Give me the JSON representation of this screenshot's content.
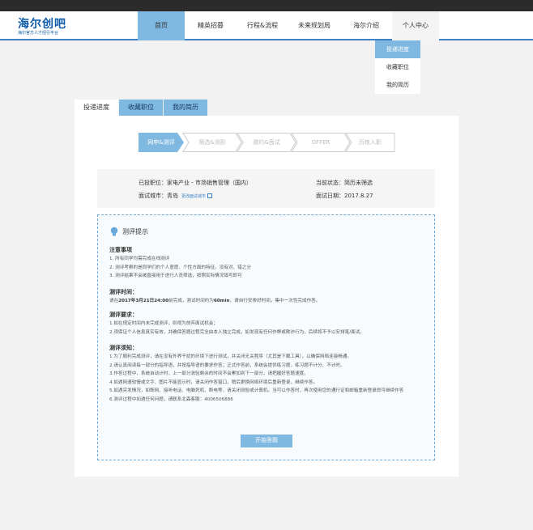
{
  "header": {
    "logo_text": "海尔创吧",
    "logo_sub": "海尔官方人才招引平台"
  },
  "nav": {
    "items": [
      {
        "label": "首页"
      },
      {
        "label": "精英招募"
      },
      {
        "label": "行程&流程"
      },
      {
        "label": "未来规划局"
      },
      {
        "label": "海尔介绍"
      },
      {
        "label": "个人中心"
      }
    ],
    "active": "首页"
  },
  "profile_menu": {
    "items": [
      {
        "label": "投递进度"
      },
      {
        "label": "收藏职位"
      },
      {
        "label": "我的简历"
      }
    ],
    "active": "投递进度"
  },
  "tabs": [
    {
      "label": "投递进度"
    },
    {
      "label": "收藏职位"
    },
    {
      "label": "我的简历"
    }
  ],
  "steps": [
    {
      "label": "网申&测评"
    },
    {
      "label": "筛选&测形"
    },
    {
      "label": "邀约&面试"
    },
    {
      "label": "OFFER"
    },
    {
      "label": "历练入职"
    }
  ],
  "application": {
    "position_label": "已投职位：",
    "position_value": "家电产业 - 市场销售管理（国内）",
    "status_label": "当前状态：",
    "status_value": "简历未筛选",
    "city_label": "面试城市：",
    "city_value": "青岛",
    "change_city": "更改面试城市",
    "date_label": "面试日期：",
    "date_value": "2017.8.27"
  },
  "notice": {
    "title": "测评提示",
    "s1_title": "注意事项",
    "s1_lines": [
      "1. 所有同学均需完成在线测评",
      "2. 测评考察的是同学们的个人意愿、个性方面的特征。没有对、错之分",
      "3. 测评结果不会被直接用于进行人员筛选，按照实际情况填写即可"
    ],
    "s2_title": "测评时间：",
    "s2_line_pre": "请在",
    "s2_deadline": "2017年3月21日24:00",
    "s2_line_mid": "前完成，测试时间约为",
    "s2_duration": "60min",
    "s2_line_post": "，请自行安排好时间，集中一次性完成作答。",
    "s3_title": "测评要求：",
    "s3_lines": [
      "1.如在规定时间内未完成测评，则视为放弃面试机会；",
      "2.须保证个人信息真实有效，并确保答题过程完全由本人独立完成，如发现有任何作弊或欺诈行为，后续将不予以安排笔/面试。"
    ],
    "s4_title": "测评须知：",
    "s4_lines": [
      "1.为了顺利完成测评，请在没有外界干扰的环境下进行测试，并关闭无关程序（尤其是下载工具），以确保网络连接畅通。",
      "2.请认真阅读每一部分的指导语，并按指导语的要求作答；正式作答前，系统会提供练习题，练习题不计分、不计时。",
      "3.作答过程中，系统自动计时，上一部分测验剩余的时间不会累加到下一部分，请把握好答题速度。",
      "4.如遇网速较慢或文字、图片不能显示时，请关闭作答窗口，稍后更换网络环境后重新登录，继续作答。",
      "5.如遇突发情况，如断网、接听电话、电脑死机、断电等，请关闭测验或计算机。当可以作答时，再次使用您的通行证和邮箱重新登录即可继续作答",
      "6.测评过程中如遇任何问题，请联系北森客服：4006506886"
    ],
    "start_button": "开始答题"
  },
  "colors": {
    "accent": "#7fb8e0",
    "header_border": "#3d82c5",
    "topbar": "#2b2b2b"
  }
}
